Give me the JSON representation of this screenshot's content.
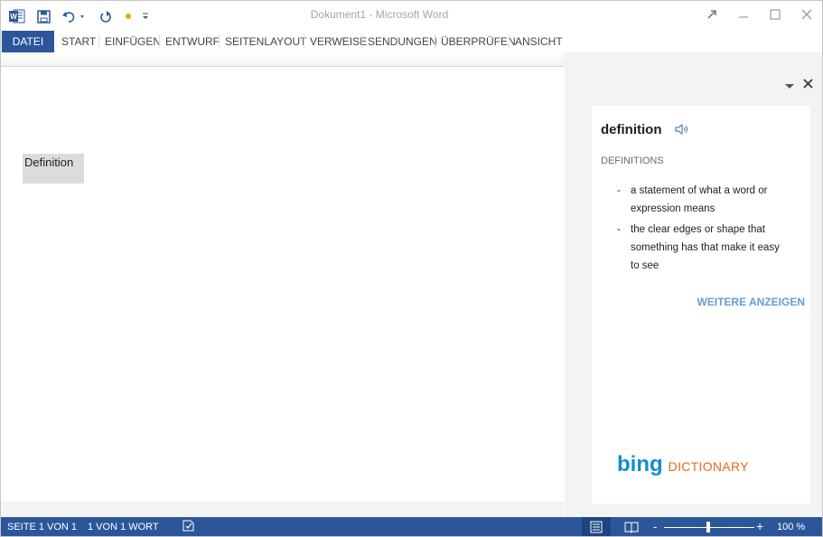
{
  "window": {
    "title": "Dokument1 - Microsoft Word",
    "minimize_icon": "minimize-icon",
    "maximize_icon": "maximize-icon",
    "close_icon": "close-icon",
    "restore_icon": "restore-arrow-icon"
  },
  "quick_access": {
    "icons": [
      "word-logo-icon",
      "save-icon",
      "undo-icon",
      "redo-icon",
      "touch-mode-icon",
      "customize-qat-icon"
    ]
  },
  "ribbon": {
    "tabs": [
      {
        "label": "DATEI"
      },
      {
        "label": "START"
      },
      {
        "label": "EINFÜGEN"
      },
      {
        "label": "ENTWURF"
      },
      {
        "label": "SEITENLAYOUT"
      },
      {
        "label": "VERWEISE"
      },
      {
        "label": "SENDUNGEN"
      },
      {
        "label": "ÜBERPRÜFEN"
      },
      {
        "label": "ANSICHT"
      }
    ]
  },
  "document": {
    "selected_text": "Definition"
  },
  "taskpane": {
    "word": "definition",
    "section_header": "DEFINITIONS",
    "definitions": [
      {
        "dash": "-",
        "text": "a statement of what a word or expression means"
      },
      {
        "dash": "-",
        "text": "the clear edges or shape that something has that make it easy to see"
      }
    ],
    "more_link": "WEITERE ANZEIGEN",
    "brand_primary": "bing",
    "brand_secondary": "DICTIONARY",
    "colors": {
      "bing_blue": "#0f8fcf",
      "dictionary_orange": "#e8681b",
      "link_blue": "#6a9bd2"
    }
  },
  "statusbar": {
    "page": "SEITE 1 VON 1",
    "words": "1 VON 1 WORT",
    "zoom_minus": "-",
    "zoom_plus": "+",
    "zoom": "100 %",
    "zoom_level": 100,
    "color": "#2b579a"
  }
}
